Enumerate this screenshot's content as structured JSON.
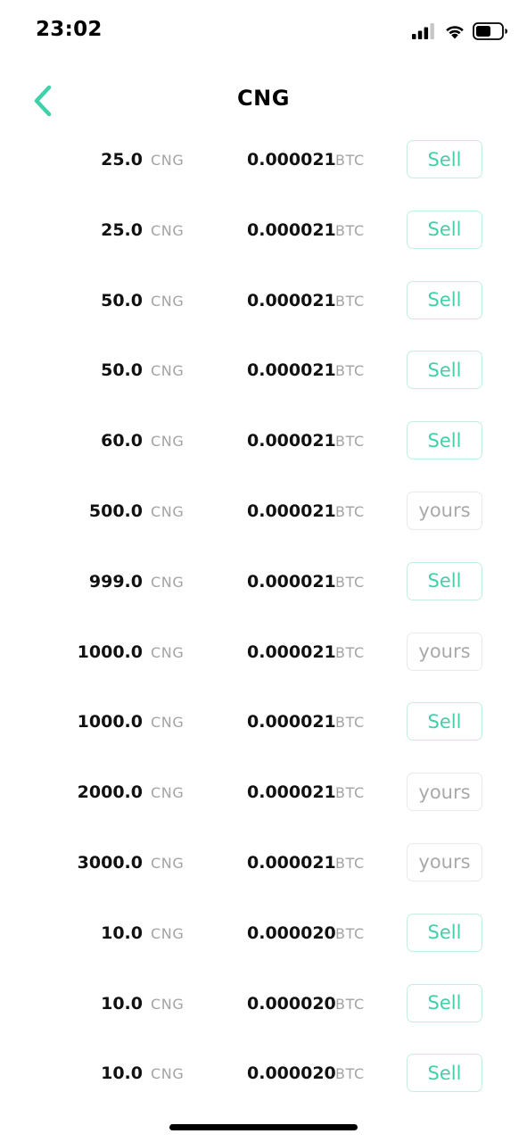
{
  "status_bar": {
    "time": "23:02"
  },
  "nav": {
    "title": "CNG",
    "back_icon": "chevron-left-icon"
  },
  "colors": {
    "accent": "#3fd1a9",
    "accent_border": "#c2efe3",
    "muted_text": "#a3a3a3",
    "yours_text": "#a9a9a9",
    "yours_border": "#e9e9e9"
  },
  "orders": [
    {
      "amount": "25.0",
      "amount_unit": "CNG",
      "price": "0.000021",
      "price_unit": "BTC",
      "action": "Sell",
      "type": "sell"
    },
    {
      "amount": "25.0",
      "amount_unit": "CNG",
      "price": "0.000021",
      "price_unit": "BTC",
      "action": "Sell",
      "type": "sell"
    },
    {
      "amount": "50.0",
      "amount_unit": "CNG",
      "price": "0.000021",
      "price_unit": "BTC",
      "action": "Sell",
      "type": "sell"
    },
    {
      "amount": "50.0",
      "amount_unit": "CNG",
      "price": "0.000021",
      "price_unit": "BTC",
      "action": "Sell",
      "type": "sell"
    },
    {
      "amount": "60.0",
      "amount_unit": "CNG",
      "price": "0.000021",
      "price_unit": "BTC",
      "action": "Sell",
      "type": "sell"
    },
    {
      "amount": "500.0",
      "amount_unit": "CNG",
      "price": "0.000021",
      "price_unit": "BTC",
      "action": "yours",
      "type": "yours"
    },
    {
      "amount": "999.0",
      "amount_unit": "CNG",
      "price": "0.000021",
      "price_unit": "BTC",
      "action": "Sell",
      "type": "sell"
    },
    {
      "amount": "1000.0",
      "amount_unit": "CNG",
      "price": "0.000021",
      "price_unit": "BTC",
      "action": "yours",
      "type": "yours"
    },
    {
      "amount": "1000.0",
      "amount_unit": "CNG",
      "price": "0.000021",
      "price_unit": "BTC",
      "action": "Sell",
      "type": "sell"
    },
    {
      "amount": "2000.0",
      "amount_unit": "CNG",
      "price": "0.000021",
      "price_unit": "BTC",
      "action": "yours",
      "type": "yours"
    },
    {
      "amount": "3000.0",
      "amount_unit": "CNG",
      "price": "0.000021",
      "price_unit": "BTC",
      "action": "yours",
      "type": "yours"
    },
    {
      "amount": "10.0",
      "amount_unit": "CNG",
      "price": "0.000020",
      "price_unit": "BTC",
      "action": "Sell",
      "type": "sell"
    },
    {
      "amount": "10.0",
      "amount_unit": "CNG",
      "price": "0.000020",
      "price_unit": "BTC",
      "action": "Sell",
      "type": "sell"
    },
    {
      "amount": "10.0",
      "amount_unit": "CNG",
      "price": "0.000020",
      "price_unit": "BTC",
      "action": "Sell",
      "type": "sell"
    }
  ]
}
